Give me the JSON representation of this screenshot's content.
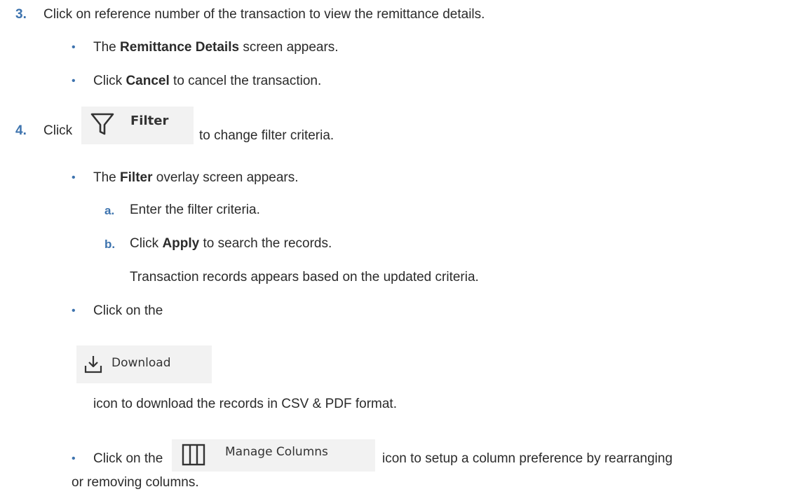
{
  "steps": {
    "step3": {
      "number": "3.",
      "text": "Click on reference number of the transaction to view the remittance details.",
      "bullets": [
        {
          "pre": "The ",
          "bold": "Remittance Details",
          "post": " screen appears."
        },
        {
          "pre": "Click ",
          "bold": "Cancel",
          "post": " to cancel the transaction."
        }
      ]
    },
    "step4": {
      "number": "4.",
      "pre": "Click",
      "post": "to change filter criteria.",
      "filter_button_label": "Filter",
      "bullet1": {
        "pre": "The ",
        "bold": "Filter",
        "post": " overlay screen appears."
      },
      "substeps": [
        {
          "letter": "a.",
          "pre": "Enter the filter criteria.",
          "bold": "",
          "post": ""
        },
        {
          "letter": "b.",
          "pre": "Click ",
          "bold": "Apply",
          "post": " to search the records."
        }
      ],
      "result": "Transaction records appears based on the updated criteria.",
      "bullet2": {
        "pre": "Click on the",
        "download_label": "Download",
        "post": "icon to download the records in CSV & PDF format."
      },
      "bullet3": {
        "pre": "Click on the",
        "manage_label": "Manage Columns",
        "post_line1": "icon to setup a column preference by rearranging",
        "post_line2": "or removing columns."
      }
    }
  },
  "bullet_char": "•",
  "icons": {
    "filter": "filter-funnel-icon",
    "download": "download-icon",
    "manage": "columns-icon"
  }
}
